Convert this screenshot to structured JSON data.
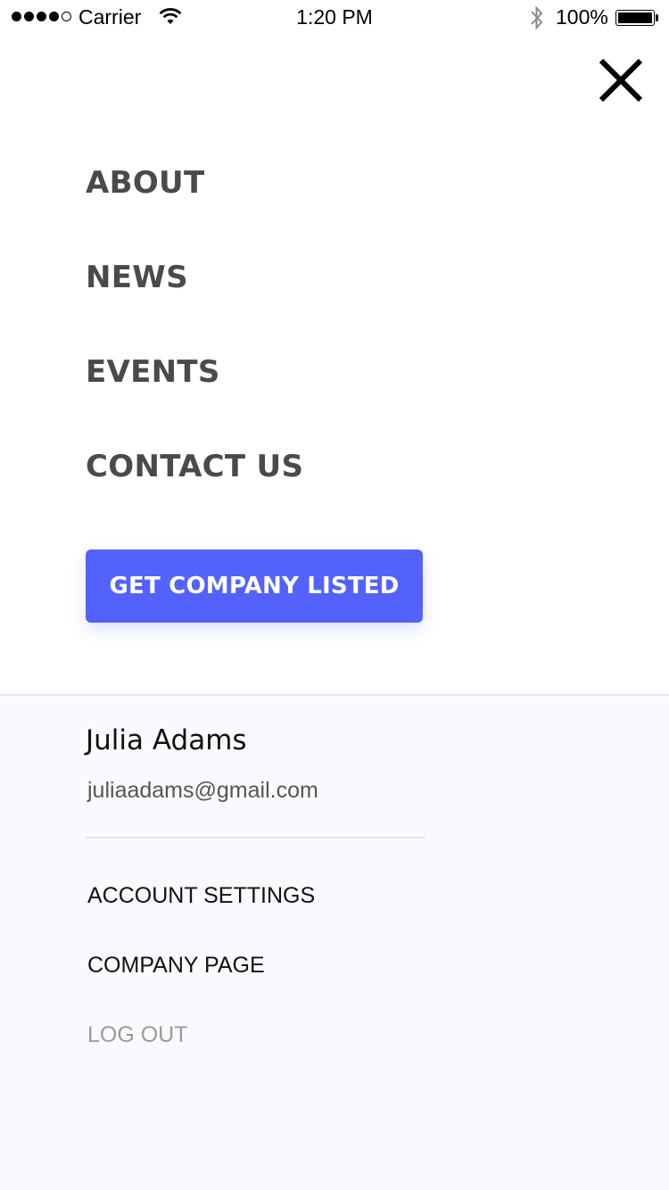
{
  "status_bar": {
    "carrier": "Carrier",
    "time": "1:20 PM",
    "battery": "100%",
    "signal_bars_filled": 4,
    "signal_bars_total": 5
  },
  "menu": {
    "items": [
      {
        "label": "ABOUT"
      },
      {
        "label": "NEWS"
      },
      {
        "label": "EVENTS"
      },
      {
        "label": "CONTACT US"
      }
    ],
    "cta_label": "GET COMPANY LISTED",
    "close_icon": "close-icon"
  },
  "account": {
    "name": "Julia Adams",
    "email": "juliaadams@gmail.com",
    "links": [
      {
        "label": "ACCOUNT SETTINGS"
      },
      {
        "label": "COMPANY PAGE"
      },
      {
        "label": "LOG OUT"
      }
    ]
  },
  "colors": {
    "accent": "#5362fc",
    "menu_text": "#4a4a4a",
    "panel_bg": "#f9fafd",
    "muted_text": "#9a9a9a"
  }
}
